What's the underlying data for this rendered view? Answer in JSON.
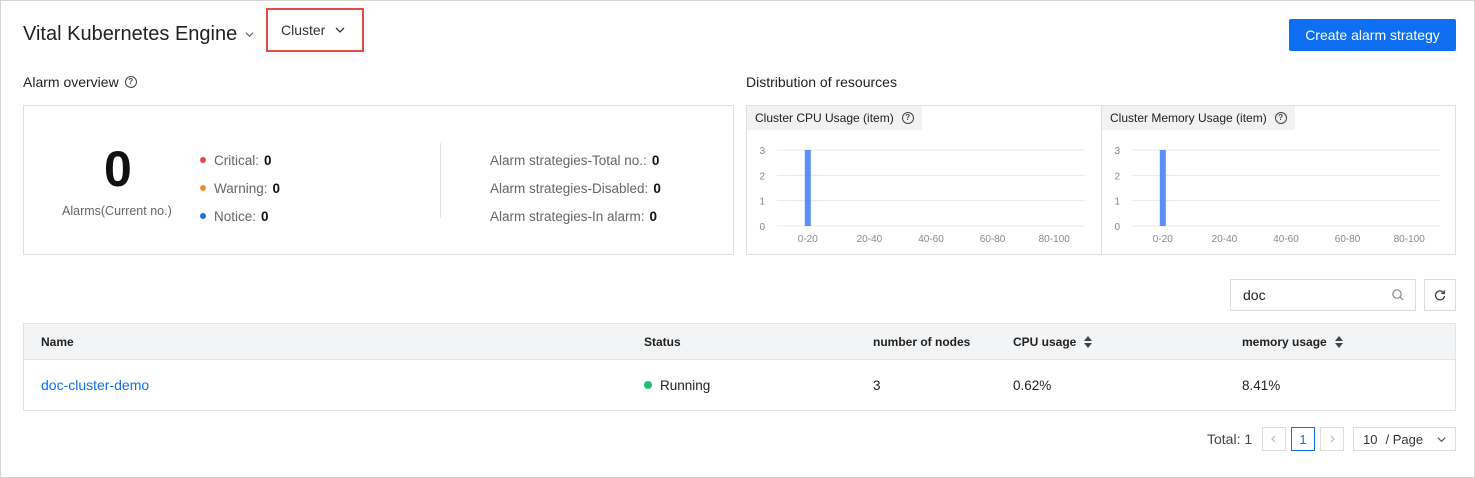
{
  "header": {
    "app_title": "Vital Kubernetes Engine",
    "cluster_select": "Cluster",
    "create_button": "Create alarm strategy"
  },
  "alarm_overview": {
    "title": "Alarm overview",
    "count": "0",
    "count_label": "Alarms(Current no.)",
    "levels": [
      {
        "label": "Critical:",
        "value": "0",
        "color": "#e5484d"
      },
      {
        "label": "Warning:",
        "value": "0",
        "color": "#f28c28"
      },
      {
        "label": "Notice:",
        "value": "0",
        "color": "#1f6fe5"
      }
    ],
    "strategies": [
      {
        "label": "Alarm strategies-Total no.:",
        "value": "0"
      },
      {
        "label": "Alarm strategies-Disabled:",
        "value": "0"
      },
      {
        "label": "Alarm strategies-In alarm:",
        "value": "0"
      }
    ]
  },
  "distribution": {
    "title": "Distribution of resources"
  },
  "chart_data": [
    {
      "type": "bar",
      "title": "Cluster CPU Usage (item)",
      "categories": [
        "0-20",
        "20-40",
        "40-60",
        "60-80",
        "80-100"
      ],
      "values": [
        3,
        0,
        0,
        0,
        0
      ],
      "yticks": [
        "0",
        "1",
        "2",
        "3"
      ],
      "ylim": [
        0,
        3
      ],
      "grid": true,
      "color": "#5b8ff9"
    },
    {
      "type": "bar",
      "title": "Cluster Memory Usage (item)",
      "categories": [
        "0-20",
        "20-40",
        "40-60",
        "60-80",
        "80-100"
      ],
      "values": [
        3,
        0,
        0,
        0,
        0
      ],
      "yticks": [
        "0",
        "1",
        "2",
        "3"
      ],
      "ylim": [
        0,
        3
      ],
      "grid": true,
      "color": "#5b8ff9"
    }
  ],
  "search": {
    "value": "doc"
  },
  "table": {
    "columns": [
      "Name",
      "Status",
      "number of nodes",
      "CPU usage",
      "memory usage"
    ],
    "rows": [
      {
        "name": "doc-cluster-demo",
        "status": "Running",
        "nodes": "3",
        "cpu": "0.62%",
        "memory": "8.41%"
      }
    ]
  },
  "pagination": {
    "total": "Total: 1",
    "current_page": "1",
    "page_size": "10",
    "page_size_suffix": "/ Page"
  }
}
